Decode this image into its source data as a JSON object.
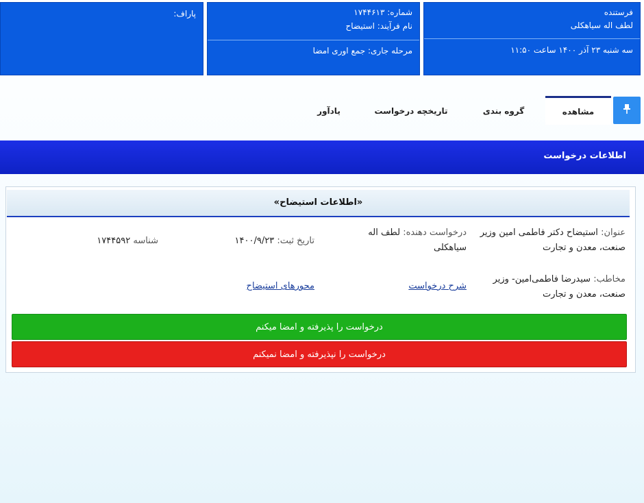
{
  "header": {
    "sender": {
      "label": "فرستنده",
      "name": "لطف اله سیاهکلی",
      "datetime": "سه شنبه ۲۳ آذر ۱۴۰۰ ساعت ۱۱:۵۰"
    },
    "request": {
      "number": "شماره: ۱۷۴۴۶۱۳",
      "process": "نام فرآیند: استیضاح",
      "stage": "مرحله جاری: جمع اوری امضا"
    },
    "attachments": {
      "label": "پاراف:"
    }
  },
  "tabs": [
    "مشاهده",
    "گروه بندی",
    "تاریخچه درخواست",
    "یادآور"
  ],
  "active_tab": "مشاهده",
  "section_title": "اطلاعات درخواست",
  "card": {
    "title": "«اطلاعات استیضاح»",
    "subject_label": "عنوان:",
    "subject_value": "استیضاح دکتر فاطمی امین وزیر صنعت، معدن و تجارت",
    "requester_label": "درخواست دهنده:",
    "requester_value": "لطف اله سیاهکلی",
    "date_label": "تاریخ ثبت:",
    "date_value": "۱۴۰۰/۹/۲۳",
    "id_label": "شناسه",
    "id_value": "۱۷۴۴۵۹۲",
    "addressee_label": "مخاطب:",
    "addressee_value": "سیدرضا فاطمی‌امین- وزیر صنعت، معدن و تجارت",
    "link_description": "شرح درخواست",
    "link_axes": "محورهای استیضاح"
  },
  "buttons": {
    "accept": "درخواست را پذیرفته و امضا میکنم",
    "reject": "درخواست را نپذیرفته و امضا نمیکنم"
  },
  "colors": {
    "accent_blue": "#0a5ce0",
    "accept_green": "#1cb01c",
    "reject_red": "#e8201e"
  },
  "icons": {
    "pin": "pin-icon"
  }
}
